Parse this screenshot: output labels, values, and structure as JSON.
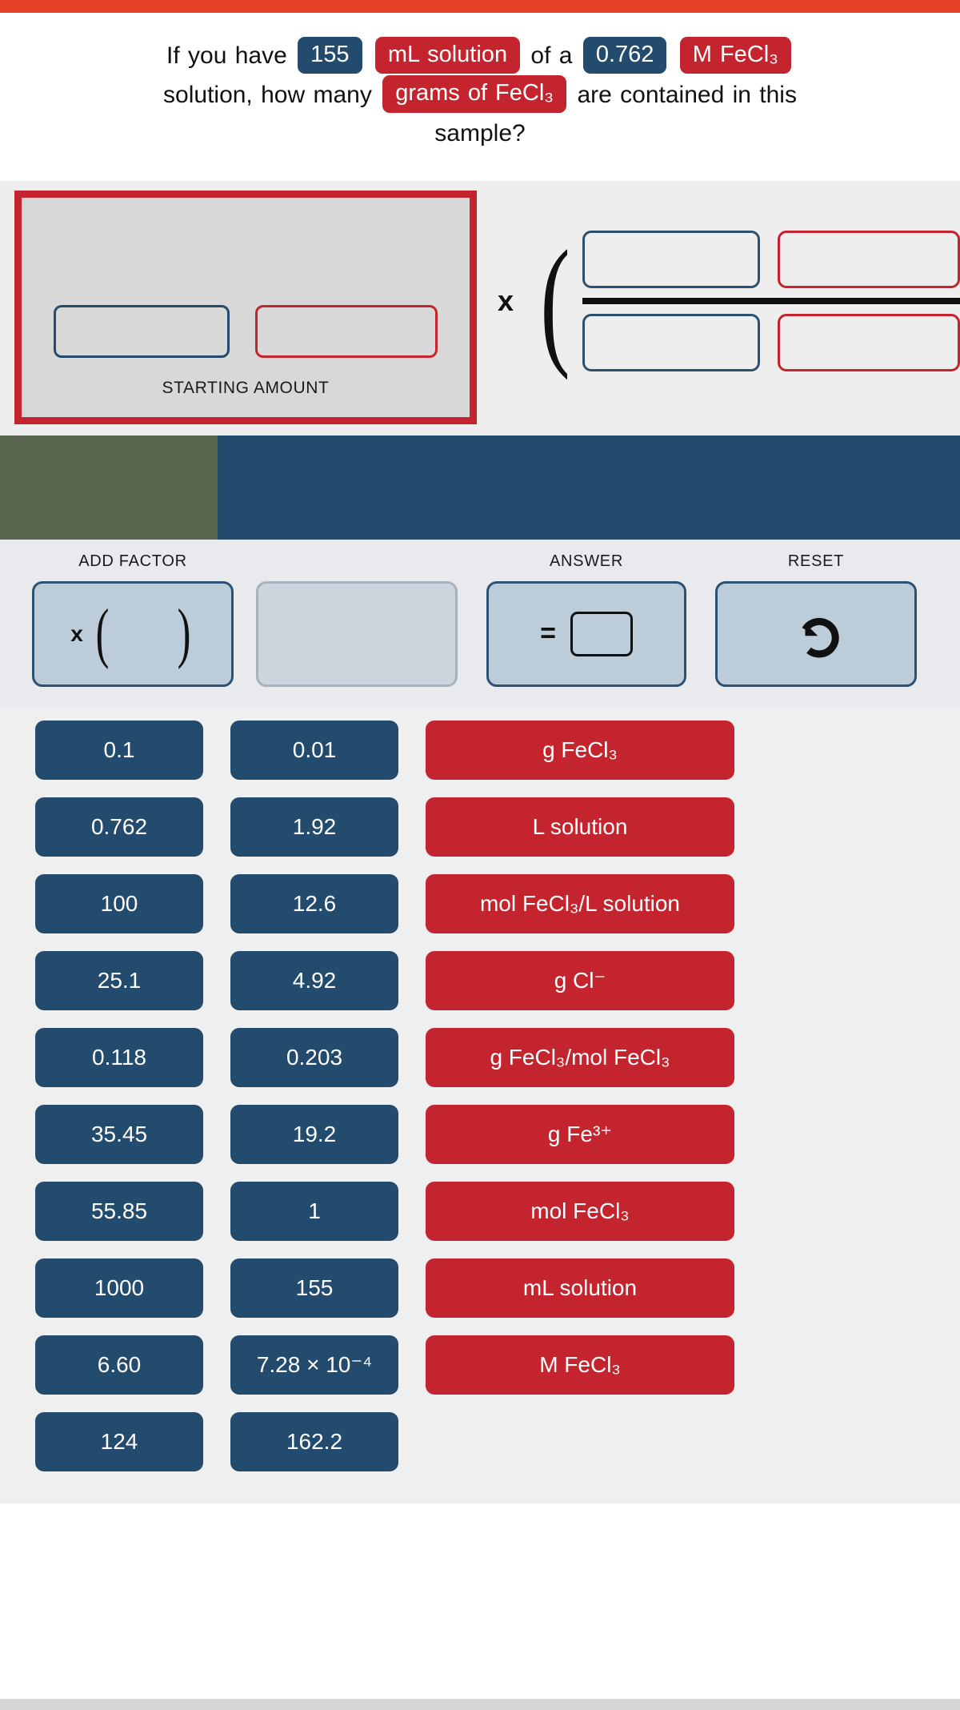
{
  "theme": {
    "accent_red": "#e8412a",
    "value_blue": "#234b6e",
    "unit_red": "#c4242e",
    "olive": "#5b6650",
    "panel_gray": "#efefef"
  },
  "question": {
    "part1": "If you have",
    "given_volume": "155",
    "given_volume_unit": "mL solution",
    "part2": "of a",
    "given_conc": "0.762",
    "given_conc_unit": "M FeCl₃",
    "part3": "solution, how many",
    "target_unit": "grams of  FeCl₃",
    "part4": "are contained in this",
    "part5": "sample?"
  },
  "work_area": {
    "starting_amount_label": "STARTING AMOUNT",
    "starting_value": "",
    "starting_unit": "",
    "multiply_symbol": "x",
    "factor": {
      "numerator_value": "",
      "numerator_unit": "",
      "denominator_value": "",
      "denominator_unit": ""
    }
  },
  "toolbar": {
    "add_factor_label": "ADD FACTOR",
    "add_factor_symbol": "x (   )",
    "answer_label": "ANSWER",
    "answer_equals": "=",
    "answer_value": "",
    "reset_label": "RESET",
    "reset_icon": "undo-arrow-icon"
  },
  "tiles": {
    "values_col1": [
      "0.1",
      "0.762",
      "100",
      "25.1",
      "0.118",
      "35.45",
      "55.85",
      "1000",
      "6.60",
      "124"
    ],
    "values_col2": [
      "0.01",
      "1.92",
      "12.6",
      "4.92",
      "0.203",
      "19.2",
      "1",
      "155",
      "7.28 × 10⁻⁴",
      "162.2"
    ],
    "units": [
      "g FeCl₃",
      "L solution",
      "mol FeCl₃/L solution",
      "g Cl⁻",
      "g FeCl₃/mol FeCl₃",
      "g Fe³⁺",
      "mol FeCl₃",
      "mL solution",
      "M FeCl₃"
    ]
  }
}
